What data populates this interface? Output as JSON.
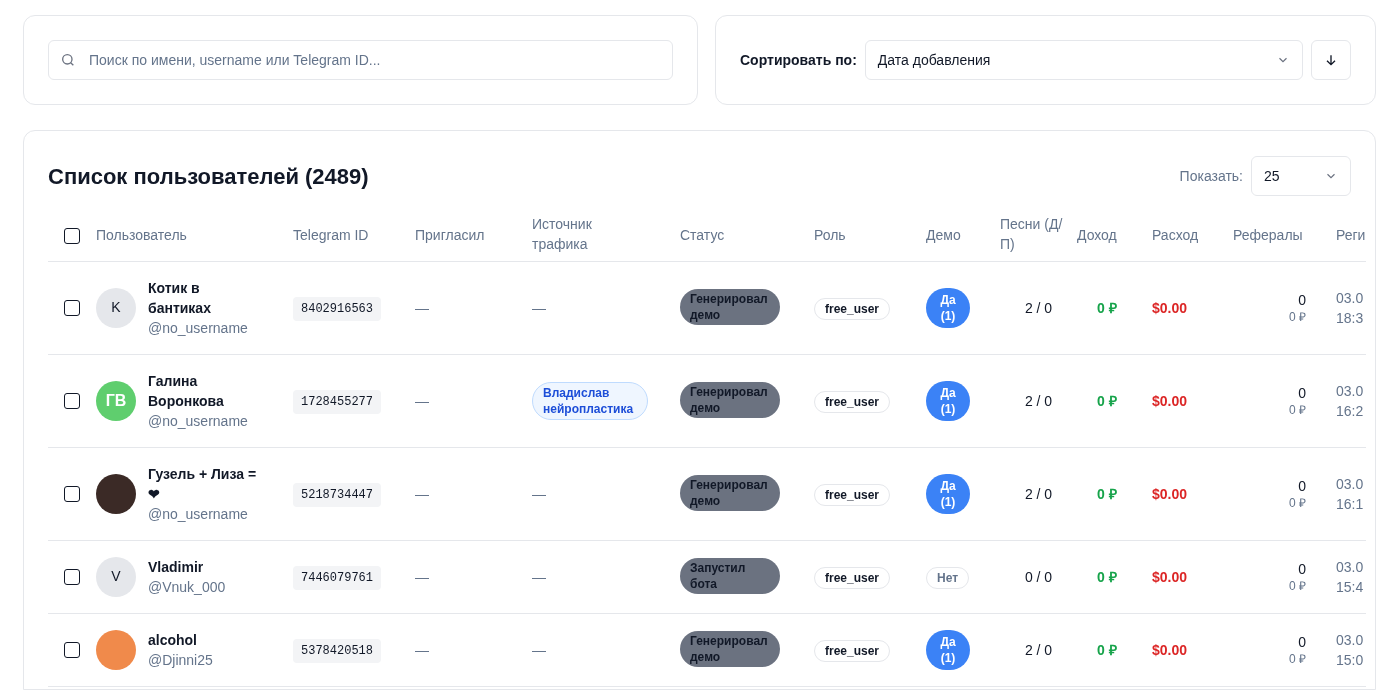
{
  "search": {
    "placeholder": "Поиск по имени, username или Telegram ID..."
  },
  "sort": {
    "label": "Сортировать по:",
    "value": "Дата добавления"
  },
  "users_card": {
    "title": "Список пользователей (2489)",
    "page_size_label": "Показать:",
    "page_size": "25"
  },
  "table": {
    "select_all": {
      "checked": false
    },
    "columns": [
      "Пользователь",
      "Telegram ID",
      "Пригласил",
      "Источник трафика",
      "Статус",
      "Роль",
      "Демо",
      "Песни (Д/П)",
      "Доход",
      "Расход",
      "Рефералы",
      "Реги"
    ],
    "rows": [
      {
        "checked": false,
        "avatar": {
          "kind": "letter",
          "text": "K",
          "color": "#e5e7eb"
        },
        "name": "Котик в бантиках",
        "username": "@no_username",
        "telegram_id": "8402916563",
        "invited": "—",
        "source": {
          "kind": "dash",
          "text": "—"
        },
        "status": "Генерировал демо",
        "role": "free_user",
        "demo": {
          "kind": "yes",
          "text": "Да (1)"
        },
        "songs": "2 / 0",
        "income": "0 ₽",
        "expense": "$0.00",
        "referrals": "0",
        "referral_income": "0 ₽",
        "reg_date": "03.0",
        "reg_time": "18:3"
      },
      {
        "checked": false,
        "avatar": {
          "kind": "initials",
          "text": "ГВ",
          "color": "#5fce6e"
        },
        "name": "Галина Воронкова",
        "username": "@no_username",
        "telegram_id": "1728455277",
        "invited": "—",
        "source": {
          "kind": "tag",
          "text": "Владислав нейропластика"
        },
        "status": "Генерировал демо",
        "role": "free_user",
        "demo": {
          "kind": "yes",
          "text": "Да (1)"
        },
        "songs": "2 / 0",
        "income": "0 ₽",
        "expense": "$0.00",
        "referrals": "0",
        "referral_income": "0 ₽",
        "reg_date": "03.0",
        "reg_time": "16:2"
      },
      {
        "checked": false,
        "avatar": {
          "kind": "photo",
          "color": "#3b2a26"
        },
        "name": "Гузель + Лиза = ❤",
        "username": "@no_username",
        "telegram_id": "5218734447",
        "invited": "—",
        "source": {
          "kind": "dash",
          "text": "—"
        },
        "status": "Генерировал демо",
        "role": "free_user",
        "demo": {
          "kind": "yes",
          "text": "Да (1)"
        },
        "songs": "2 / 0",
        "income": "0 ₽",
        "expense": "$0.00",
        "referrals": "0",
        "referral_income": "0 ₽",
        "reg_date": "03.0",
        "reg_time": "16:1"
      },
      {
        "checked": false,
        "avatar": {
          "kind": "letter",
          "text": "V",
          "color": "#e5e7eb"
        },
        "name": "Vladimir",
        "username": "@Vnuk_000",
        "telegram_id": "7446079761",
        "invited": "—",
        "source": {
          "kind": "dash",
          "text": "—"
        },
        "status": "Запустил бота",
        "role": "free_user",
        "demo": {
          "kind": "no",
          "text": "Нет"
        },
        "songs": "0 / 0",
        "income": "0 ₽",
        "expense": "$0.00",
        "referrals": "0",
        "referral_income": "0 ₽",
        "reg_date": "03.0",
        "reg_time": "15:4"
      },
      {
        "checked": false,
        "avatar": {
          "kind": "picture",
          "color": "#f08a4b"
        },
        "name": "alcohol",
        "username": "@Djinni25",
        "telegram_id": "5378420518",
        "invited": "—",
        "source": {
          "kind": "dash",
          "text": "—"
        },
        "status": "Генерировал демо",
        "role": "free_user",
        "demo": {
          "kind": "yes",
          "text": "Да (1)"
        },
        "songs": "2 / 0",
        "income": "0 ₽",
        "expense": "$0.00",
        "referrals": "0",
        "referral_income": "0 ₽",
        "reg_date": "03.0",
        "reg_time": "15:0"
      }
    ]
  }
}
